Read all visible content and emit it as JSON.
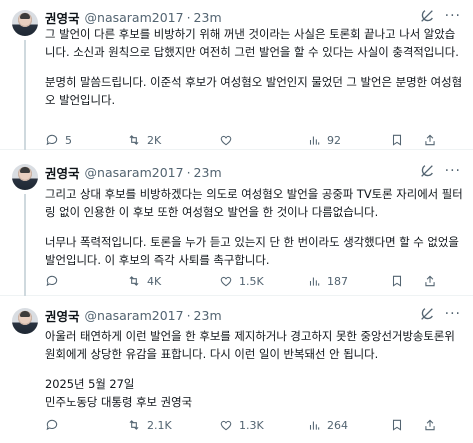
{
  "tweets": [
    {
      "author": "권영국",
      "handle": "@nasaram2017",
      "time": "23m",
      "paragraphs": [
        "그 발언이 다른 후보를 비방하기 위해 꺼낸 것이라는 사실은 토론회 끝나고 나서 알았습니다. 소신과 원칙으로 답했지만 여전히 그런 발언을 할 수 있다는 사실이 충격적입니다.",
        "분명히 말씀드립니다. 이준석 후보가 여성혐오 발언인지 물었던 그 발언은 분명한 여성혐오 발언입니다."
      ],
      "replies": "5",
      "retweets": "2K",
      "likes": "",
      "views": "92"
    },
    {
      "author": "권영국",
      "handle": "@nasaram2017",
      "time": "23m",
      "paragraphs": [
        "그리고 상대 후보를 비방하겠다는 의도로 여성혐오 발언을 공중파 TV토론 자리에서 필터링 없이 인용한 이 후보 또한 여성혐오 발언을 한 것이나 다름없습니다.",
        "너무나 폭력적입니다. 토론을 누가 듣고 있는지 단 한 번이라도 생각했다면 할 수 없었을 발언입니다. 이 후보의 즉각 사퇴를 촉구합니다."
      ],
      "replies": "",
      "retweets": "4K",
      "likes": "1.5K",
      "views": "187"
    },
    {
      "author": "권영국",
      "handle": "@nasaram2017",
      "time": "23m",
      "paragraphs": [
        "아울러 태연하게 이런 발언을 한 후보를 제지하거나 경고하지 못한 중앙선거방송토론위원회에게 상당한 유감을 표합니다. 다시 이런 일이 반복돼선 안 됩니다.",
        "2025년 5월 27일\n민주노동당 대통령 후보 권영국"
      ],
      "replies": "",
      "retweets": "2.1K",
      "likes": "1.3K",
      "views": "264"
    }
  ],
  "colors": {
    "text": "#0f1419",
    "secondary": "#536471",
    "divider": "#eff3f4",
    "thread_line": "#cfd9de"
  },
  "icons": [
    "grok-icon",
    "more-icon",
    "reply-icon",
    "retweet-icon",
    "like-icon",
    "views-icon",
    "bookmark-icon",
    "share-icon"
  ]
}
